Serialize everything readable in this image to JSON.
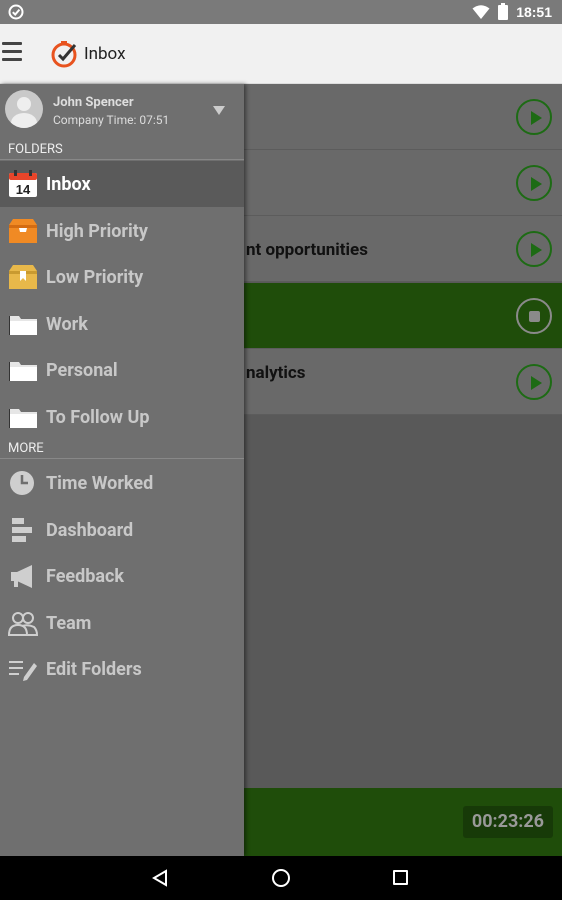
{
  "status_bar": {
    "time": "18:51"
  },
  "app_bar": {
    "title": "Inbox"
  },
  "background_list": {
    "rows": [
      {
        "text": ""
      },
      {
        "text": ""
      },
      {
        "text": "nt opportunities"
      },
      {
        "text": ""
      },
      {
        "text": "nalytics"
      }
    ],
    "timer": "00:23:26"
  },
  "drawer": {
    "profile": {
      "name": "John Spencer",
      "subtitle": "Company Time: 07:51"
    },
    "folders_header": "FOLDERS",
    "folders": [
      {
        "label": "Inbox",
        "icon": "calendar-icon",
        "badge": "14"
      },
      {
        "label": "High Priority",
        "icon": "orange-box-icon"
      },
      {
        "label": "Low Priority",
        "icon": "yellow-box-icon"
      },
      {
        "label": "Work",
        "icon": "folder-icon"
      },
      {
        "label": "Personal",
        "icon": "folder-icon"
      },
      {
        "label": "To Follow Up",
        "icon": "folder-icon"
      }
    ],
    "more_header": "MORE",
    "more": [
      {
        "label": "Time Worked",
        "icon": "clock-icon"
      },
      {
        "label": "Dashboard",
        "icon": "dashboard-icon"
      },
      {
        "label": "Feedback",
        "icon": "megaphone-icon"
      },
      {
        "label": "Team",
        "icon": "team-icon"
      },
      {
        "label": "Edit Folders",
        "icon": "edit-icon"
      }
    ]
  },
  "colors": {
    "active_green": "#1f4d0a",
    "play_green": "#1d6b14",
    "drawer_bg": "#6f6f6f"
  }
}
